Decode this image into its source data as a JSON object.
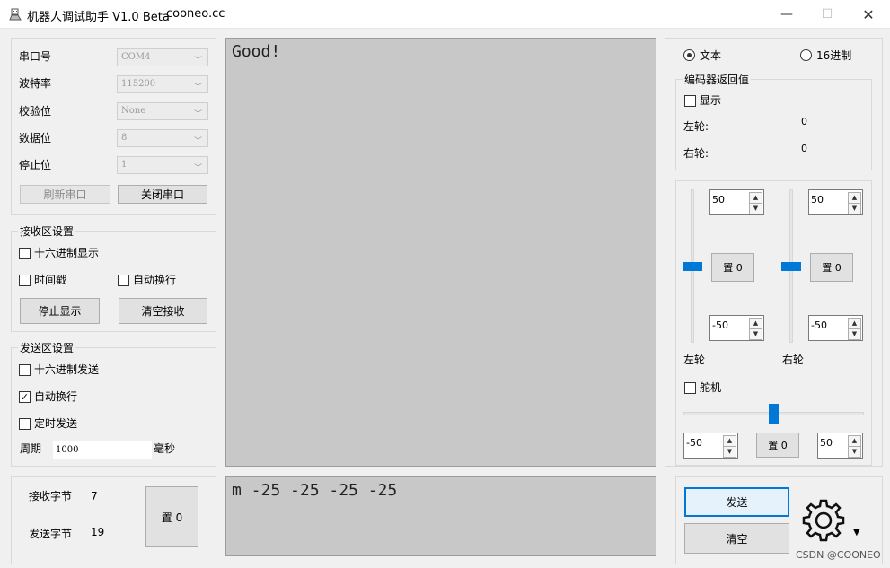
{
  "window": {
    "title": "机器人调试助手 V1.0 Beta",
    "url": "cooneo.cc",
    "minimize": "—",
    "maximize": "☐",
    "close": "✕"
  },
  "serial": {
    "port_label": "串口号",
    "port_value": "COM4",
    "baud_label": "波特率",
    "baud_value": "115200",
    "parity_label": "校验位",
    "parity_value": "None",
    "data_label": "数据位",
    "data_value": "8",
    "stop_label": "停止位",
    "stop_value": "1",
    "refresh_btn": "刷新串口",
    "close_btn": "关闭串口"
  },
  "recv_settings": {
    "title": "接收区设置",
    "hex_display": "十六进制显示",
    "timestamp": "时间戳",
    "auto_newline": "自动换行",
    "stop_display_btn": "停止显示",
    "clear_recv_btn": "清空接收"
  },
  "send_settings": {
    "title": "发送区设置",
    "hex_send": "十六进制发送",
    "auto_newline": "自动换行",
    "timed_send": "定时发送",
    "period_label": "周期",
    "period_value": "1000",
    "period_unit": "毫秒"
  },
  "stats": {
    "recv_label": "接收字节",
    "recv_value": "7",
    "send_label": "发送字节",
    "send_value": "19",
    "reset_btn": "置 0"
  },
  "receive_text": "Good!",
  "send_text": "m -25 -25 -25 -25",
  "mode": {
    "text_label": "文本",
    "hex_label": "16进制"
  },
  "encoder": {
    "title": "编码器返回值",
    "show_label": "显示",
    "left_label": "左轮:",
    "left_value": "0",
    "right_label": "右轮:",
    "right_value": "0"
  },
  "wheels": {
    "left_max": "50",
    "left_reset": "置 0",
    "left_min": "-50",
    "left_label": "左轮",
    "left_level": 0.5,
    "right_max": "50",
    "right_reset": "置 0",
    "right_min": "-50",
    "right_label": "右轮",
    "right_level": 0.5
  },
  "servo": {
    "label": "舵机",
    "min": "-50",
    "reset": "置 0",
    "max": "50",
    "level": 0.5
  },
  "actions": {
    "send_btn": "发送",
    "clear_btn": "清空"
  },
  "watermark": "CSDN @COONEO",
  "colors": {
    "accent": "#0078d7",
    "text_area": "#c8c8c8"
  }
}
